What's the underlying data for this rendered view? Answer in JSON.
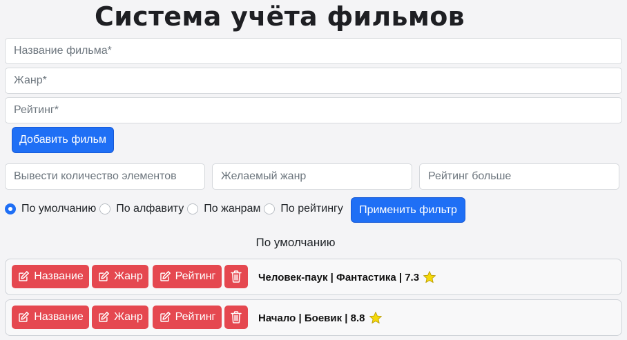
{
  "header": {
    "title": "Система учёта фильмов"
  },
  "add_form": {
    "name_placeholder": "Название фильма*",
    "genre_placeholder": "Жанр*",
    "rating_placeholder": "Рейтинг*",
    "submit_label": "Добавить фильм"
  },
  "filters": {
    "count_placeholder": "Вывести количество элементов",
    "genre_placeholder": "Желаемый жанр",
    "rating_placeholder": "Рейтинг больше",
    "sort_options": [
      {
        "label": "По умолчанию",
        "checked": true
      },
      {
        "label": "По алфавиту",
        "checked": false
      },
      {
        "label": "По жанрам",
        "checked": false
      },
      {
        "label": "По рейтингу",
        "checked": false
      }
    ],
    "apply_label": "Применить фильтр"
  },
  "list": {
    "sort_title": "По умолчанию",
    "edit_name_label": "Название",
    "edit_genre_label": "Жанр",
    "edit_rating_label": "Рейтинг",
    "movies": [
      {
        "title": "Человек-паук",
        "genre": "Фантастика",
        "rating": "7.3",
        "display": "Человек-паук | Фантастика | 7.3"
      },
      {
        "title": "Начало",
        "genre": "Боевик",
        "rating": "8.8",
        "display": "Начало | Боевик | 8.8"
      }
    ]
  },
  "colors": {
    "primary": "#1f6ff5",
    "danger": "#e54850",
    "star": "#f5d90a",
    "background": "#f4f4f6"
  },
  "icons": [
    "edit-icon",
    "trash-icon",
    "star-icon"
  ]
}
